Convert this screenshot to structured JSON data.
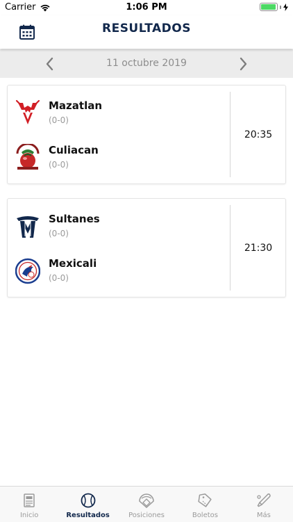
{
  "status_bar": {
    "carrier": "Carrier",
    "time": "1:06 PM",
    "battery_level": 0.95
  },
  "header": {
    "title": "RESULTADOS",
    "calendar_icon": "calendar-icon"
  },
  "date_nav": {
    "label": "11 octubre 2019",
    "prev_icon": "chevron-left-icon",
    "next_icon": "chevron-right-icon"
  },
  "games": [
    {
      "home": {
        "name": "Mazatlan",
        "record": "(0-0)",
        "logo": "venados-logo"
      },
      "away": {
        "name": "Culiacan",
        "record": "(0-0)",
        "logo": "tomateros-logo"
      },
      "time": "20:35"
    },
    {
      "home": {
        "name": "Sultanes",
        "record": "(0-0)",
        "logo": "sultanes-logo"
      },
      "away": {
        "name": "Mexicali",
        "record": "(0-0)",
        "logo": "aguilas-logo"
      },
      "time": "21:30"
    }
  ],
  "tabs": [
    {
      "label": "Inicio",
      "icon": "base-icon",
      "active": false
    },
    {
      "label": "Resultados",
      "icon": "baseball-icon",
      "active": true
    },
    {
      "label": "Posiciones",
      "icon": "field-icon",
      "active": false
    },
    {
      "label": "Boletos",
      "icon": "ticket-icon",
      "active": false
    },
    {
      "label": "Más",
      "icon": "bat-icon",
      "active": false
    }
  ],
  "colors": {
    "navy": "#12284c",
    "venados_red": "#d21f26",
    "tomateros_red": "#8b1e1e",
    "battery_green": "#4cd964"
  }
}
